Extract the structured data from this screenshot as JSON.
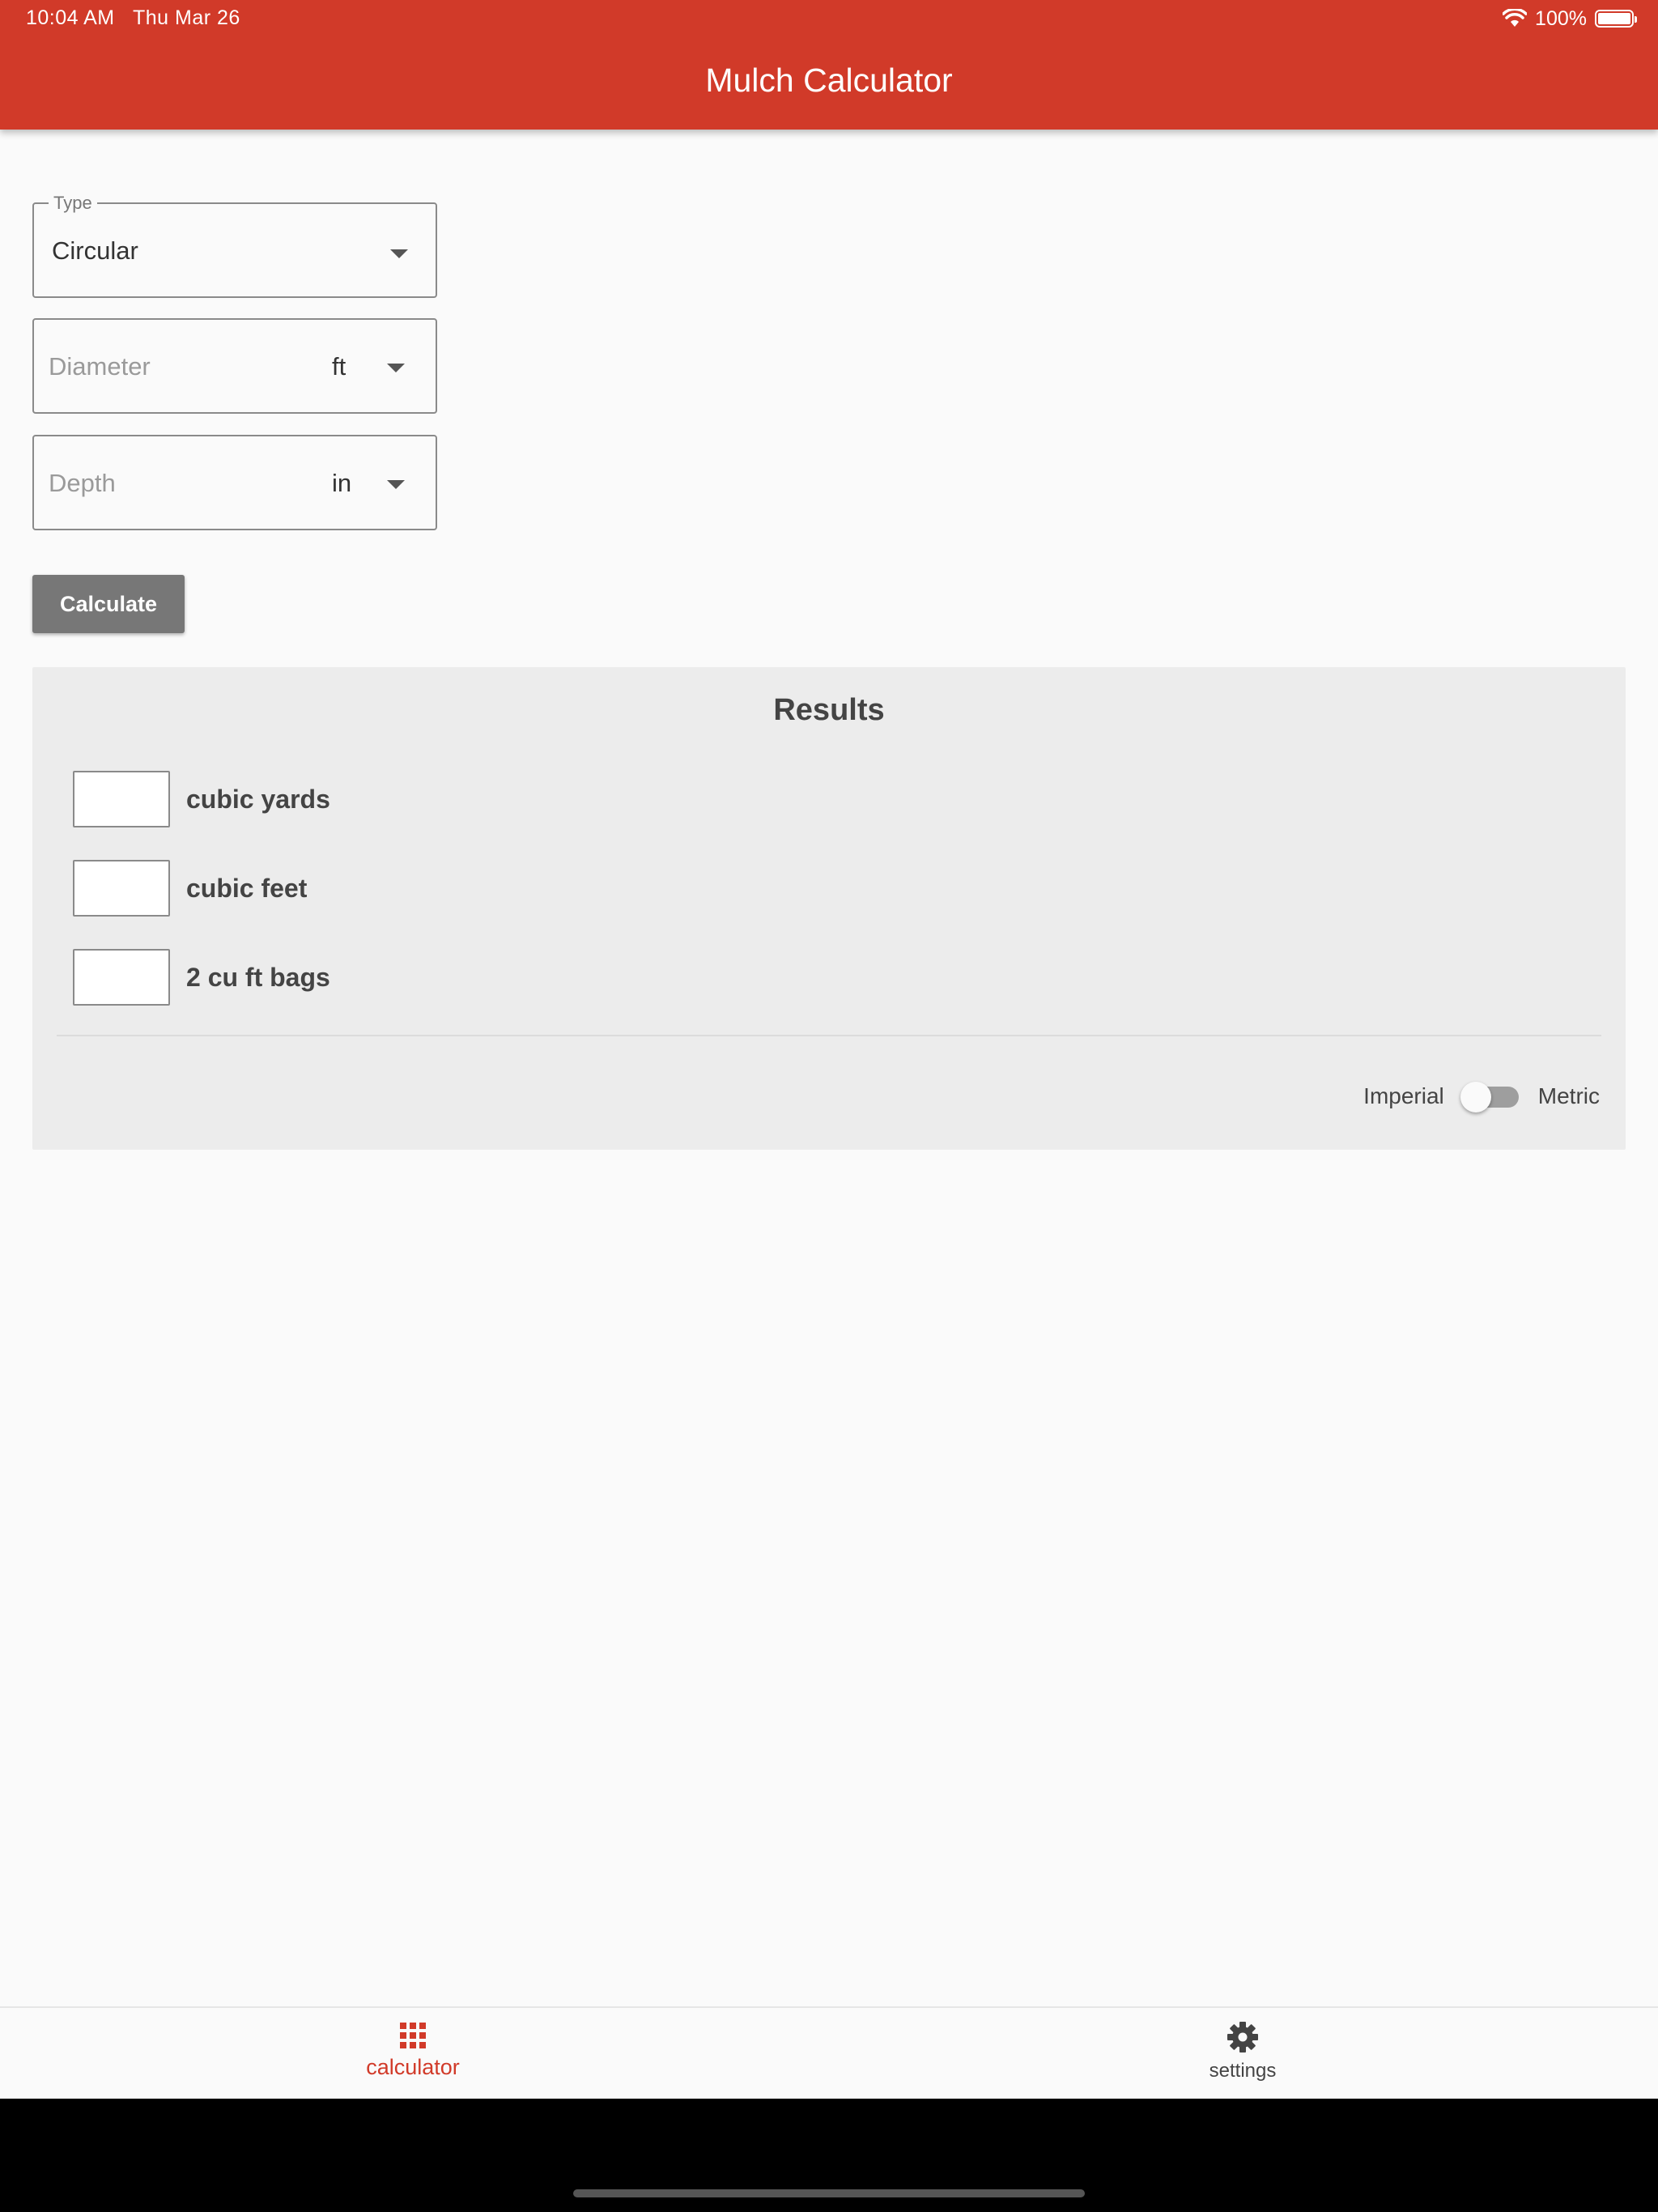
{
  "status_bar": {
    "time": "10:04 AM",
    "date": "Thu Mar 26",
    "battery": "100%"
  },
  "app_bar": {
    "title": "Mulch Calculator",
    "color": "#d13a29"
  },
  "form": {
    "type_field": {
      "legend": "Type",
      "value": "Circular"
    },
    "diameter_field": {
      "placeholder": "Diameter",
      "unit": "ft"
    },
    "depth_field": {
      "placeholder": "Depth",
      "unit": "in"
    },
    "calculate_label": "Calculate"
  },
  "results": {
    "title": "Results",
    "rows": [
      {
        "label": "cubic yards",
        "value": ""
      },
      {
        "label": "cubic feet",
        "value": ""
      },
      {
        "label": "2 cu ft bags",
        "value": ""
      }
    ],
    "toggle": {
      "left_label": "Imperial",
      "right_label": "Metric",
      "state": "Imperial"
    }
  },
  "bottom_nav": {
    "items": [
      {
        "label": "calculator",
        "icon": "grid-icon",
        "active": true
      },
      {
        "label": "settings",
        "icon": "gear-icon",
        "active": false
      }
    ]
  }
}
